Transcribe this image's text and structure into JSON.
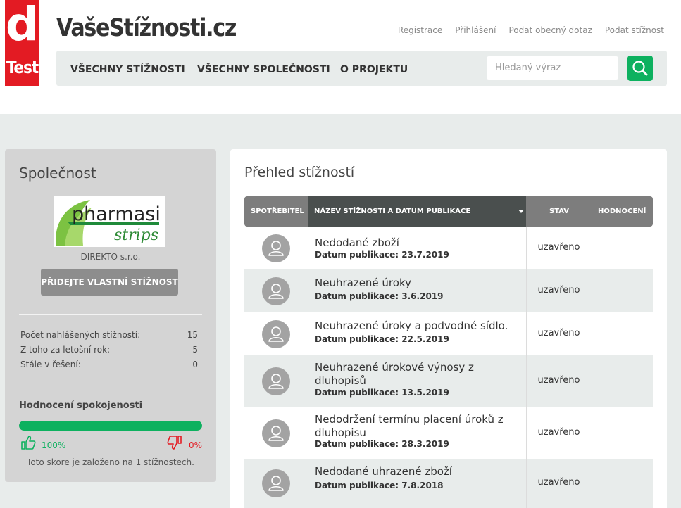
{
  "brand": {
    "logo_letter": "d",
    "logo_word": "Test",
    "site_name": "VašeStížnosti.cz",
    "accent": "#e31b23",
    "green": "#0db15f"
  },
  "top_links": [
    "Registrace",
    "Přihlášení",
    "Podat obecný dotaz",
    "Podat stížnost"
  ],
  "nav": {
    "items": [
      "VŠECHNY STÍŽNOSTI",
      "VŠECHNY SPOLEČNOSTI",
      "O PROJEKTU"
    ],
    "search_placeholder": "Hledaný výraz",
    "search_icon": "search-icon"
  },
  "sidebar": {
    "title": "Společnost",
    "company_logo_text": "pharmasi strips",
    "company_name": "DIREKTO s.r.o.",
    "add_button": "PŘIDEJTE VLASTNÍ STÍŽNOST",
    "stats": [
      {
        "label": "Počet nahlášených stížností:",
        "value": "15"
      },
      {
        "label": "Z toho za letošní rok:",
        "value": "5"
      },
      {
        "label": "Stále v řešení:",
        "value": "0"
      }
    ],
    "satisfaction_title": "Hodnocení spokojenosti",
    "satisfaction_fraction": 1.0,
    "positive_pct": "100%",
    "negative_pct": "0%",
    "score_note": "Toto skore je založeno na 1 stížnostech."
  },
  "main": {
    "title": "Přehled stížností",
    "columns": [
      "SPOTŘEBITEL",
      "NÁZEV STÍŽNOSTI A DATUM PUBLIKACE",
      "STAV",
      "HODNOCENÍ"
    ],
    "date_prefix": "Datum publikace:",
    "rows": [
      {
        "title": "Nedodané zboží",
        "date": "23.7.2019",
        "state": "uzavřeno"
      },
      {
        "title": "Neuhrazené úroky",
        "date": "3.6.2019",
        "state": "uzavřeno"
      },
      {
        "title": "Neuhrazené úroky a podvodné sídlo.",
        "date": "22.5.2019",
        "state": "uzavřeno"
      },
      {
        "title": "Neuhrazené úrokové výnosy z dluhopisů",
        "date": "13.5.2019",
        "state": "uzavřeno"
      },
      {
        "title": "Nedodržení termínu placení úroků z dluhopisu",
        "date": "28.3.2019",
        "state": "uzavřeno"
      },
      {
        "title": "Nedodané uhrazené zboží",
        "date": "7.8.2018",
        "state": "uzavřeno"
      }
    ]
  }
}
